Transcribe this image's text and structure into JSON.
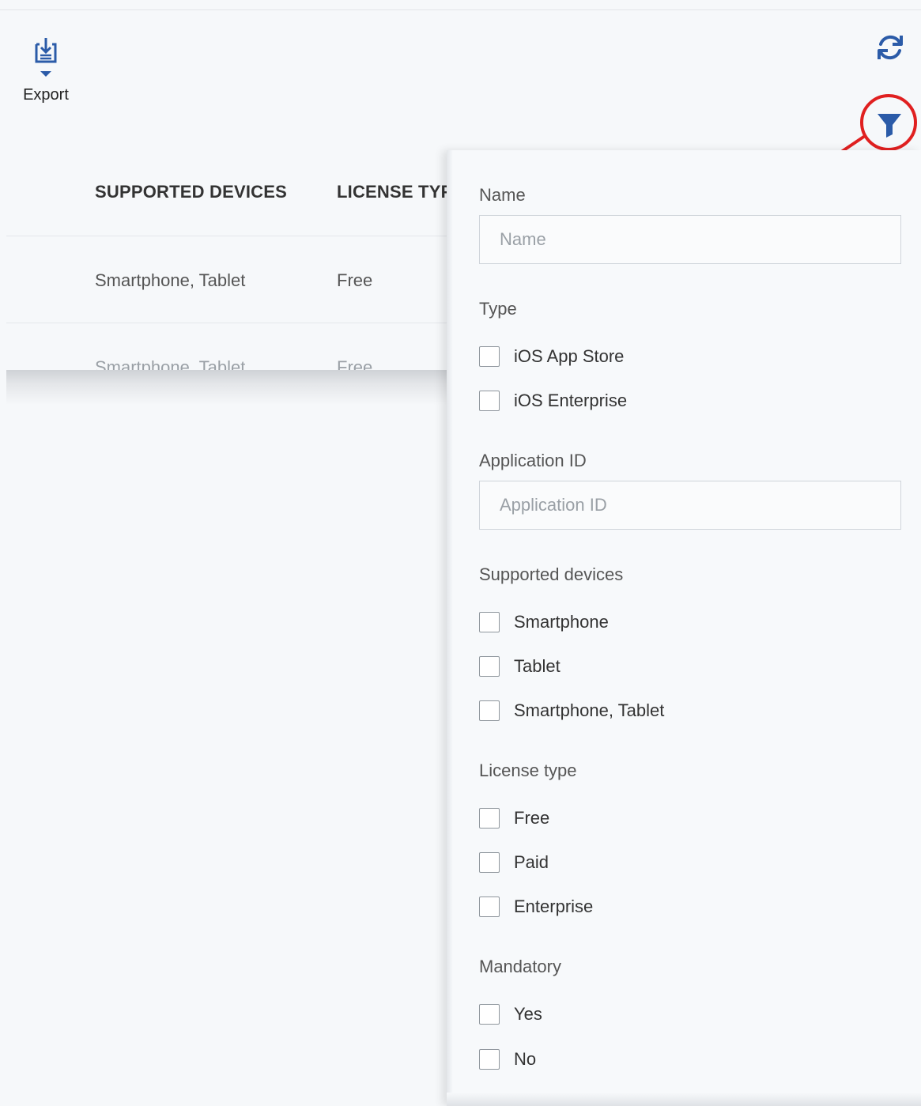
{
  "toolbar": {
    "export_label": "Export",
    "icons": [
      "export-icon",
      "refresh-icon",
      "filter-icon"
    ],
    "accent_color": "#2b5ba8",
    "annotation_color": "#e02020"
  },
  "table": {
    "columns": [
      "SUPPORTED DEVICES",
      "LICENSE TYP"
    ],
    "rows": [
      [
        "Smartphone, Tablet",
        "Free"
      ],
      [
        "Smartphone, Tablet",
        "Free"
      ]
    ]
  },
  "filter": {
    "name": {
      "label": "Name",
      "placeholder": "Name",
      "value": ""
    },
    "type": {
      "label": "Type",
      "options": [
        "iOS App Store",
        "iOS Enterprise"
      ],
      "checked": [
        false,
        false
      ]
    },
    "application_id": {
      "label": "Application ID",
      "placeholder": "Application ID",
      "value": ""
    },
    "supported_devices": {
      "label": "Supported devices",
      "options": [
        "Smartphone",
        "Tablet",
        "Smartphone, Tablet"
      ],
      "checked": [
        false,
        false,
        false
      ]
    },
    "license_type": {
      "label": "License type",
      "options": [
        "Free",
        "Paid",
        "Enterprise"
      ],
      "checked": [
        false,
        false,
        false
      ]
    },
    "mandatory": {
      "label": "Mandatory",
      "options": [
        "Yes",
        "No"
      ],
      "checked": [
        false,
        false
      ]
    }
  }
}
